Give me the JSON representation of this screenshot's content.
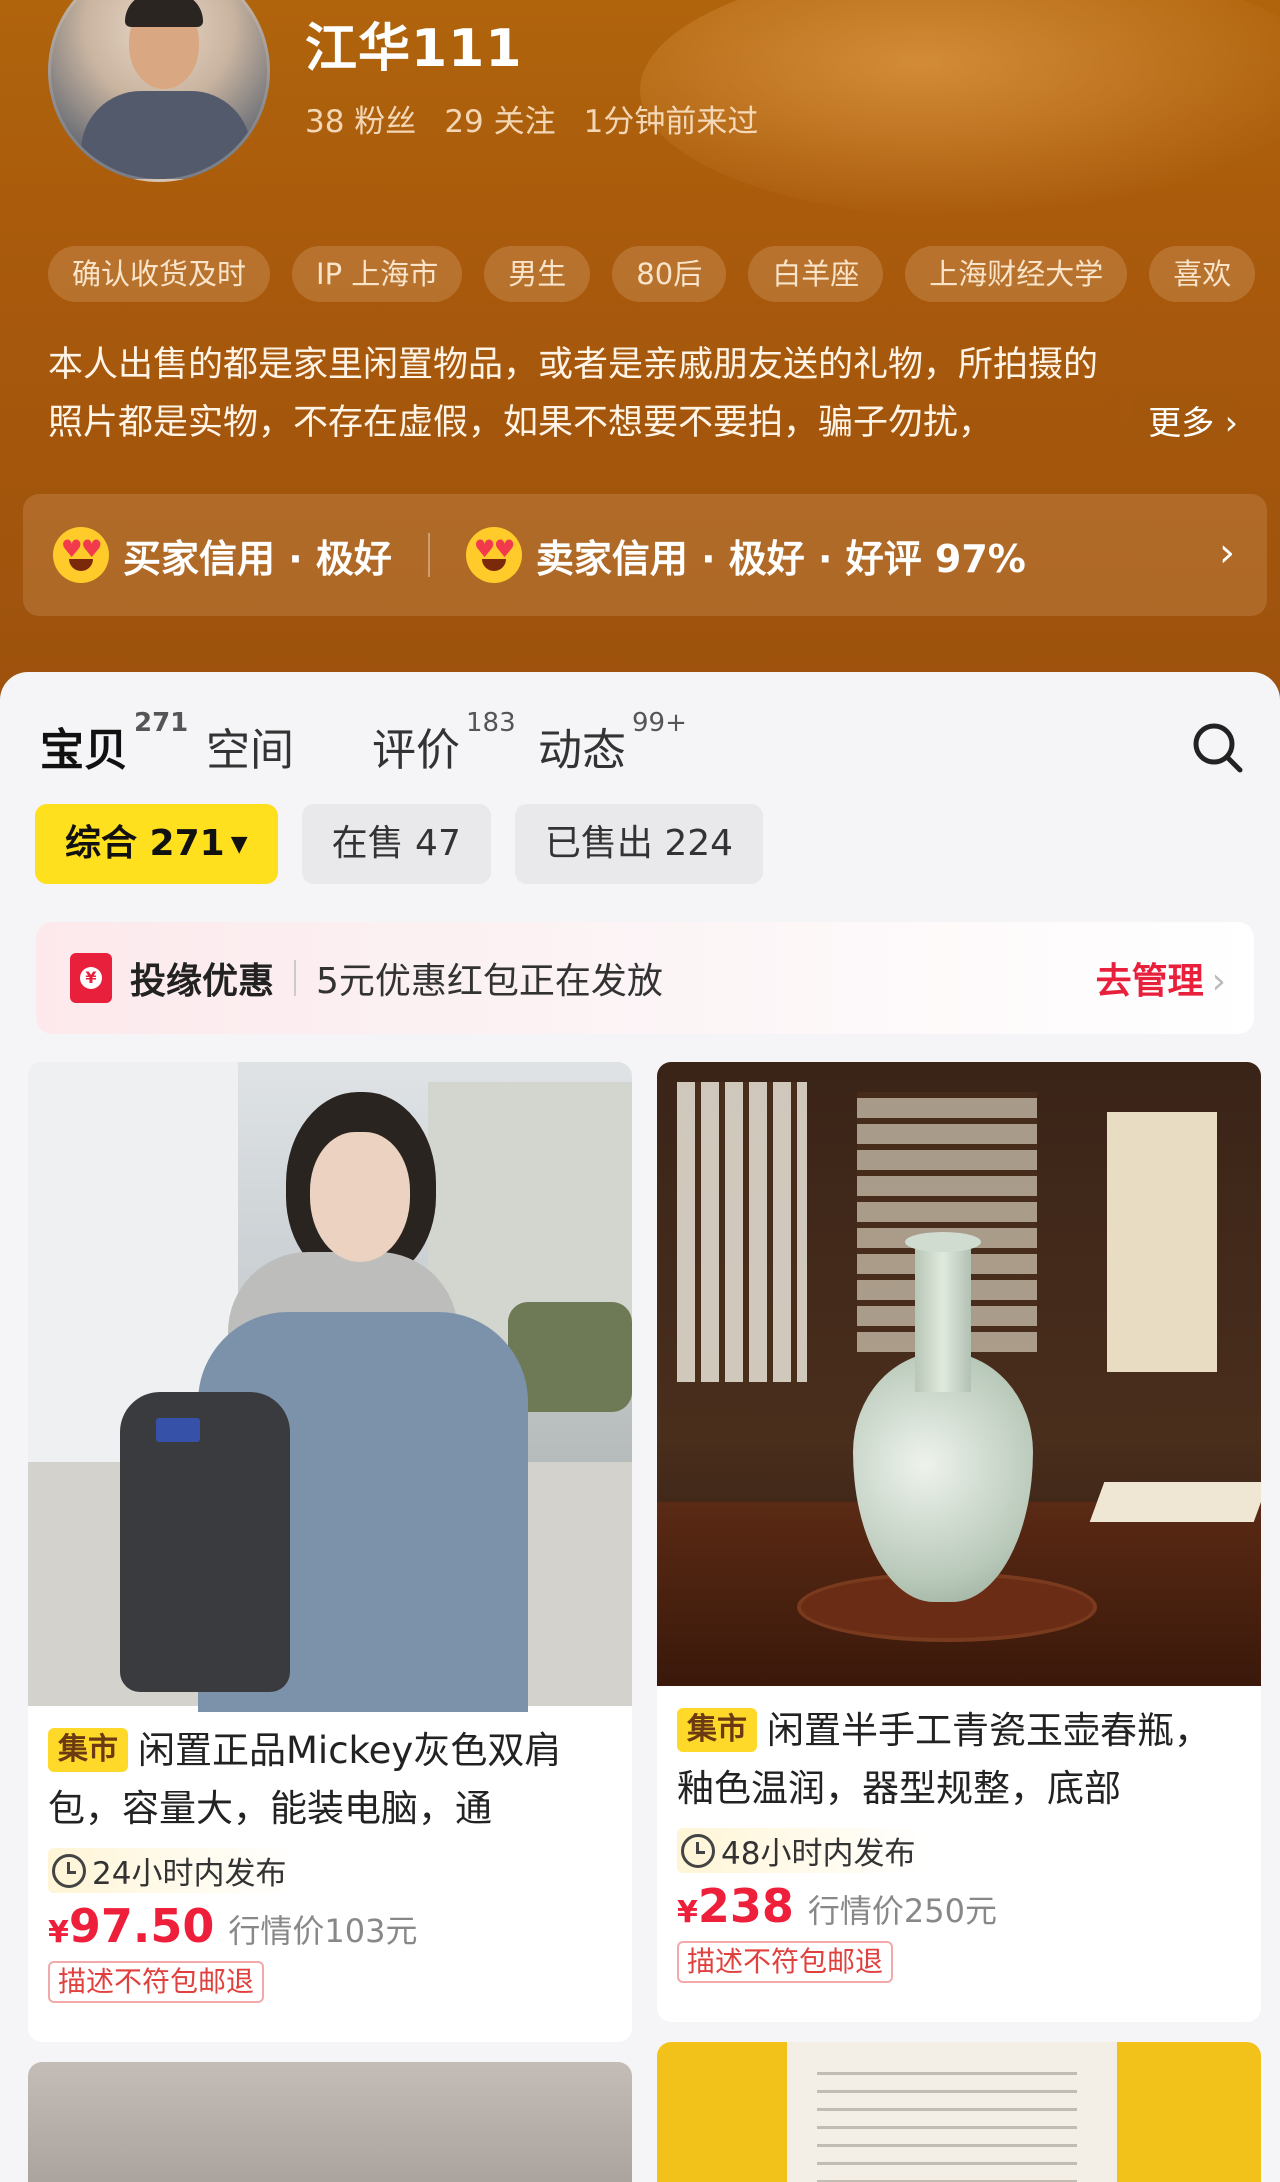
{
  "profile": {
    "username": "江华111",
    "stats": {
      "fans": "38 粉丝",
      "following": "29 关注",
      "last_seen": "1分钟前来过"
    },
    "tags": [
      "确认收货及时",
      "IP 上海市",
      "男生",
      "80后",
      "白羊座",
      "上海财经大学",
      "喜欢"
    ],
    "bio_line1": "本人出售的都是家里闲置物品，或者是亲戚朋友送的礼物，所拍摄的",
    "bio_line2": "照片都是实物，不存在虚假，如果不想要不要拍，骗子勿扰，",
    "bio_more": "更多",
    "buyer_credit": "买家信用 · 极好",
    "seller_credit": "卖家信用 · 极好 · 好评 97%"
  },
  "tabs": [
    {
      "label": "宝贝",
      "count": "271"
    },
    {
      "label": "空间",
      "count": ""
    },
    {
      "label": "评价",
      "count": "183"
    },
    {
      "label": "动态",
      "count": "99+"
    }
  ],
  "filters": {
    "all": "综合 271",
    "on_sale": "在售 47",
    "sold": "已售出 224"
  },
  "promo": {
    "title": "投缘优惠",
    "text": "5元优惠红包正在发放",
    "link": "去管理"
  },
  "items": [
    {
      "badge": "集市",
      "title": "闲置正品Mickey灰色双肩包，容量大，能装电脑，通",
      "time": "24小时内发布",
      "price_symbol": "¥",
      "price": "97.50",
      "market_price": "行情价103元",
      "refund": "描述不符包邮退"
    },
    {
      "badge": "集市",
      "title": "闲置半手工青瓷玉壶春瓶，釉色温润，器型规整，底部",
      "time": "48小时内发布",
      "price_symbol": "¥",
      "price": "238",
      "market_price": "行情价250元",
      "refund": "描述不符包邮退"
    }
  ],
  "icons": {
    "search": "search-icon",
    "chevron": "chevron-right-icon",
    "emoji": "heart-eyes-emoji-icon",
    "clock": "clock-icon",
    "red_packet": "red-packet-icon"
  },
  "colors": {
    "header": "#a8590c",
    "accent_yellow": "#ffdf2a",
    "price_red": "#ee1f3b"
  }
}
